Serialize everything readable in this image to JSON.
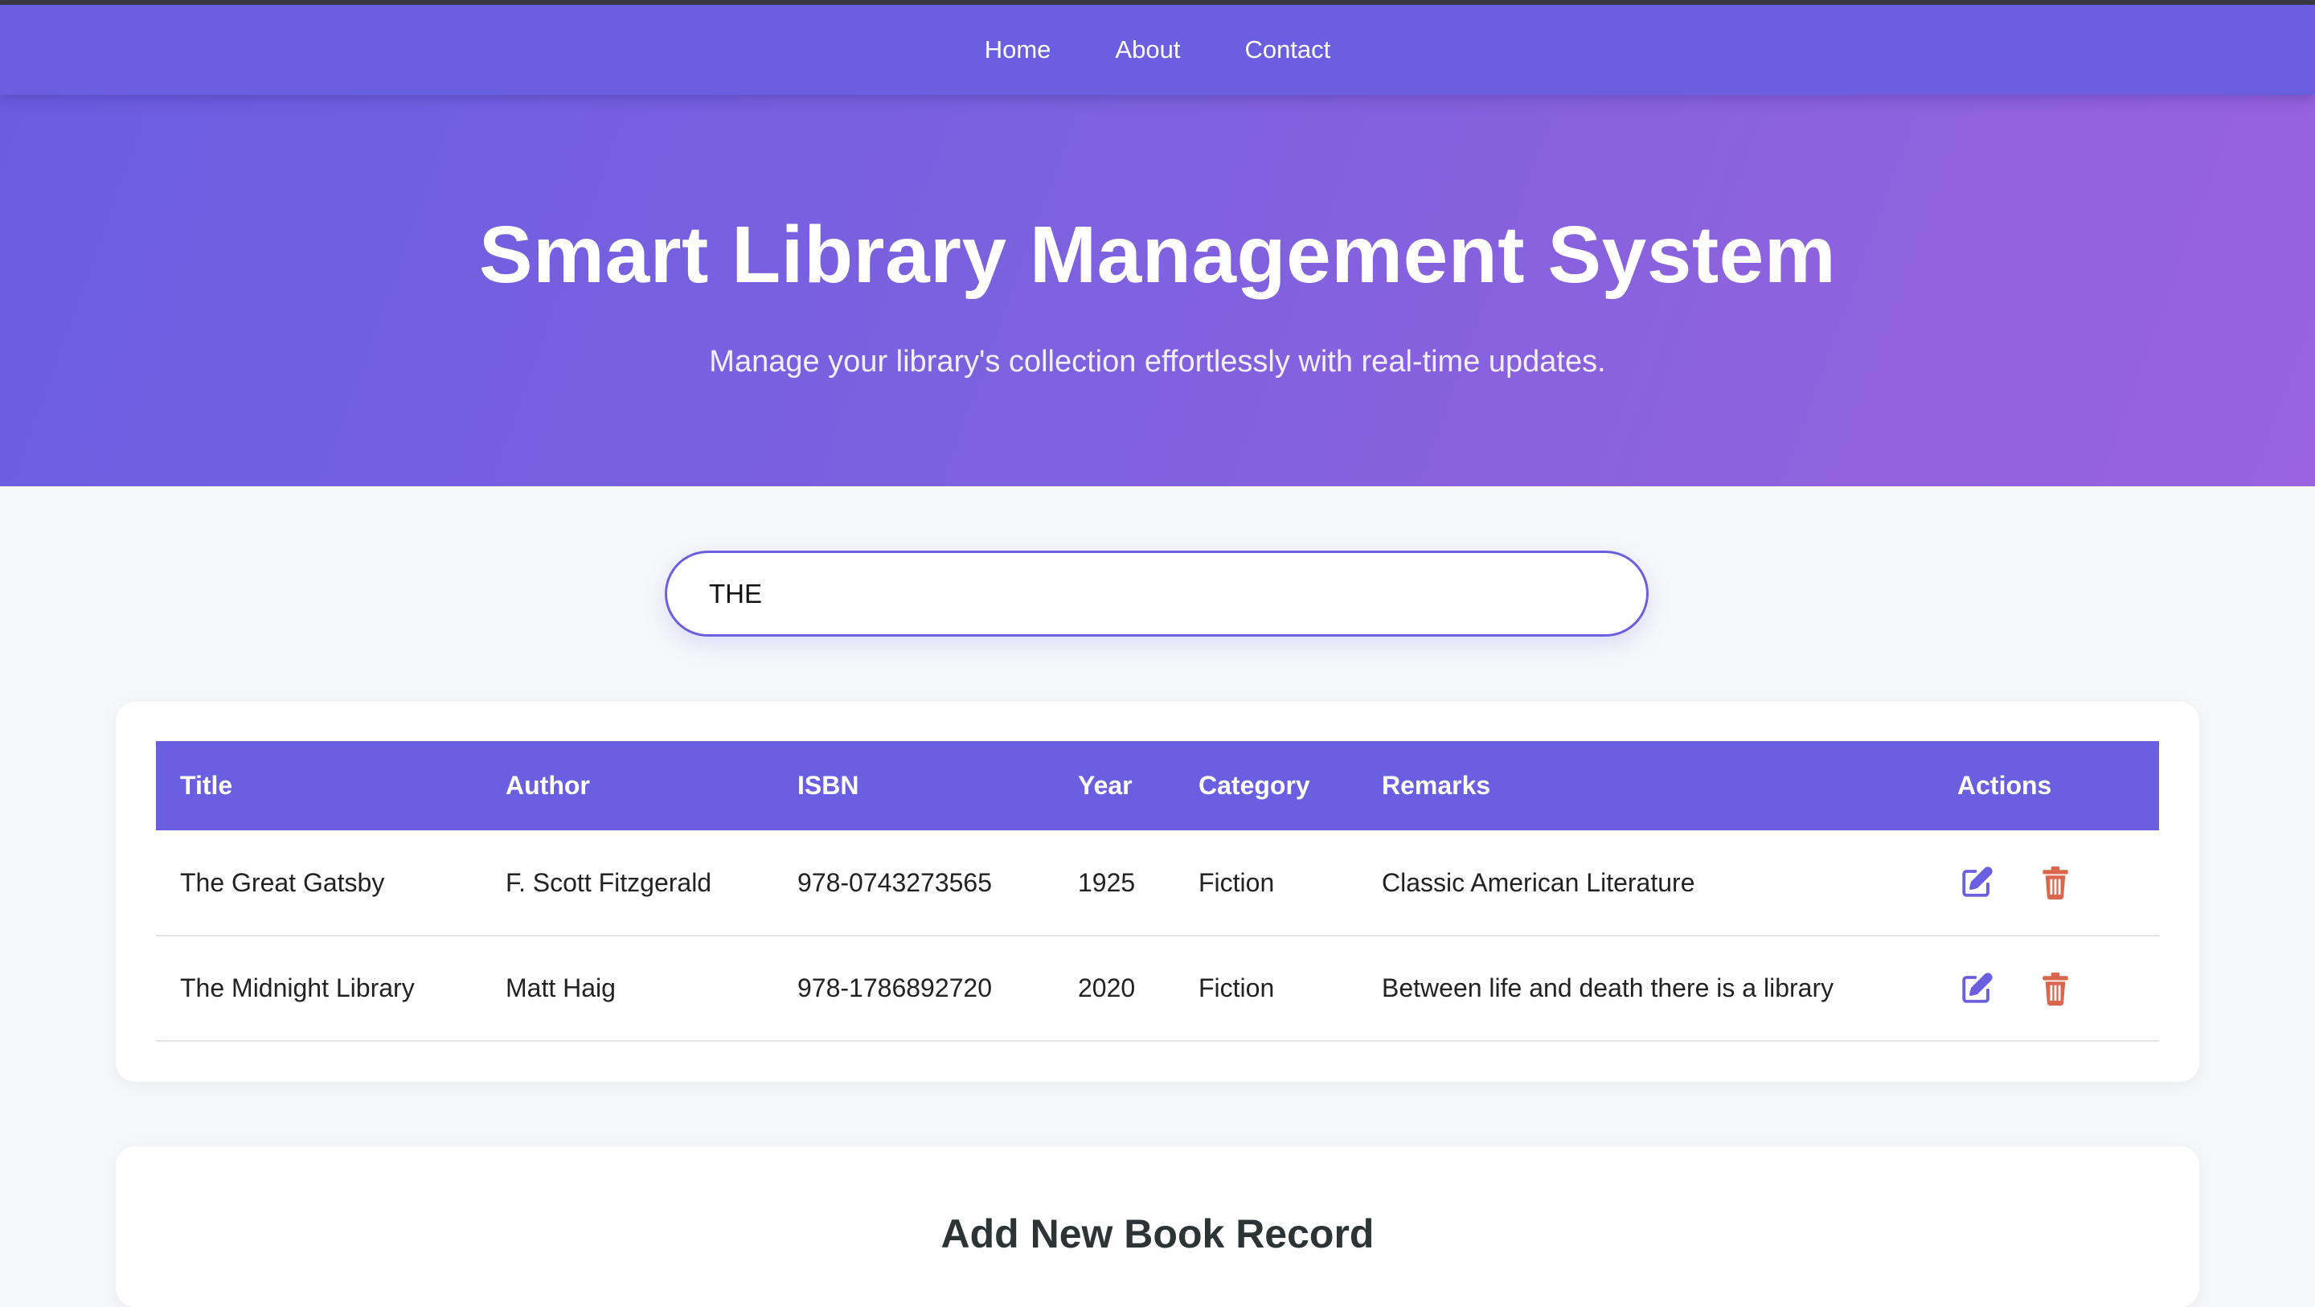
{
  "nav": {
    "links": [
      "Home",
      "About",
      "Contact"
    ]
  },
  "hero": {
    "title": "Smart Library Management System",
    "subtitle": "Manage your library's collection effortlessly with real-time updates."
  },
  "search": {
    "value": "THE"
  },
  "table": {
    "headers": [
      "Title",
      "Author",
      "ISBN",
      "Year",
      "Category",
      "Remarks",
      "Actions"
    ],
    "rows": [
      {
        "title": "The Great Gatsby",
        "author": "F. Scott Fitzgerald",
        "isbn": "978-0743273565",
        "year": "1925",
        "category": "Fiction",
        "remarks": "Classic American Literature"
      },
      {
        "title": "The Midnight Library",
        "author": "Matt Haig",
        "isbn": "978-1786892720",
        "year": "2020",
        "category": "Fiction",
        "remarks": "Between life and death there is a library"
      }
    ]
  },
  "form": {
    "title": "Add New Book Record"
  },
  "icons": {
    "edit": "edit-icon",
    "delete": "trash-icon"
  },
  "colors": {
    "accent": "#6a5fe0",
    "hero_gradient_start": "#6b5de1",
    "hero_gradient_end": "#9a62de",
    "delete": "#d9664d",
    "page_bg": "#f7f8fb"
  }
}
